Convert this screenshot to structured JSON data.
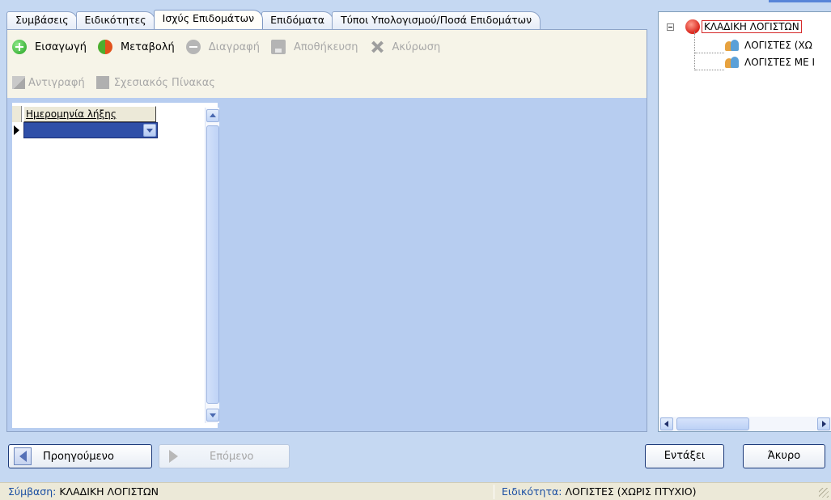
{
  "tabs": [
    {
      "label": "Συμβάσεις",
      "active": false
    },
    {
      "label": "Ειδικότητες",
      "active": false
    },
    {
      "label": "Ισχύς Επιδομάτων",
      "active": true
    },
    {
      "label": "Επιδόματα",
      "active": false
    },
    {
      "label": "Τύποι Υπολογισμού/Ποσά Επιδομάτων",
      "active": false
    }
  ],
  "toolbar": {
    "insert": {
      "label": "Εισαγωγή",
      "icon": "plus-circle-icon",
      "enabled": true
    },
    "modify": {
      "label": "Μεταβολή",
      "icon": "refresh-icon",
      "enabled": true
    },
    "delete": {
      "label": "Διαγραφή",
      "icon": "minus-circle-icon",
      "enabled": false
    },
    "save": {
      "label": "Αποθήκευση",
      "icon": "floppy-disk-icon",
      "enabled": false
    },
    "cancel": {
      "label": "Ακύρωση",
      "icon": "cross-icon",
      "enabled": false
    },
    "copy": {
      "label": "Αντιγραφή",
      "icon": "copy-icon",
      "enabled": false
    },
    "relation": {
      "label": "Σχεσιακός Πίνακας",
      "icon": "table-icon",
      "enabled": false
    }
  },
  "grid": {
    "columns": [
      "Ημερομηνία λήξης"
    ],
    "rows": [
      {
        "value": ""
      }
    ]
  },
  "tree": {
    "root": {
      "label": "ΚΛΑΔΙΚΗ ΛΟΓΙΣΤΩΝ",
      "icon": "red-ball-icon",
      "expanded": true
    },
    "children": [
      {
        "label": "ΛΟΓΙΣΤΕΣ (ΧΩ",
        "icon": "users-icon"
      },
      {
        "label": "ΛΟΓΙΣΤΕΣ ΜΕ Ι",
        "icon": "users-icon"
      }
    ]
  },
  "navigation": {
    "previous": {
      "label": "Προηγούμενο",
      "enabled": true
    },
    "next": {
      "label": "Επόμενο",
      "enabled": false
    }
  },
  "dialog": {
    "ok": "Εντάξει",
    "cancel": "Άκυρο"
  },
  "status": {
    "contract_key": "Σύμβαση:",
    "contract_value": "ΚΛΑΔΙΚΗ ΛΟΓΙΣΤΩΝ",
    "specialty_key": "Ειδικότητα:",
    "specialty_value": "ΛΟΓΙΣΤΕΣ (ΧΩΡΙΣ ΠΤΥΧΙΟ)"
  },
  "colors": {
    "window_bg": "#c5d8f2",
    "toolbar_bg": "#f6f4e8",
    "selected_row": "#2f4fa8",
    "status_key": "#1b4fa3",
    "tree_root_border": "#d62a2a"
  }
}
